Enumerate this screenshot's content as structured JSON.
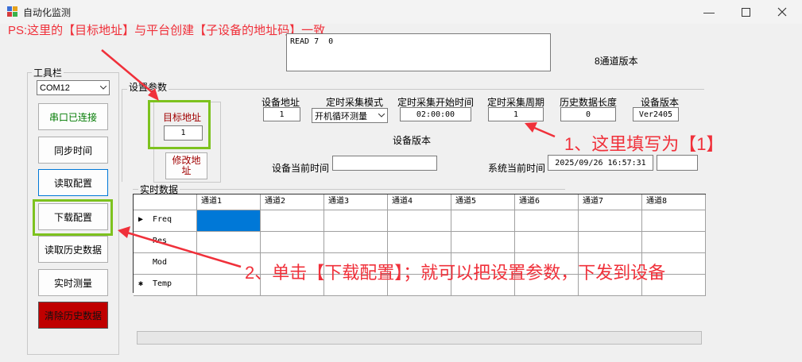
{
  "window": {
    "title": "自动化监测"
  },
  "annotations": {
    "ps": "PS:这里的【目标地址】与平台创建【子设备的地址码】一致",
    "step1": "1、这里填写为【1】",
    "step2": "2、单击【下载配置】；就可以把设置参数，下发到设备"
  },
  "output_text": "READ 7  0",
  "version_banner": "8通道版本",
  "toolbar": {
    "title": "工具栏",
    "port": "COM12",
    "buttons": {
      "connected": "串口已连接",
      "sync_time": "同步时间",
      "read_config": "读取配置",
      "download_config": "下载配置",
      "read_history": "读取历史数据",
      "realtime": "实时测量",
      "clear_history": "清除历史数据"
    }
  },
  "settings": {
    "title": "设置参数",
    "target_address_label": "目标地址",
    "target_address_value": "1",
    "modify_address": "修改地址",
    "device_address_label": "设备地址",
    "device_address_value": "1",
    "timer_mode_label": "定时采集模式",
    "timer_mode_value": "开机循环测量",
    "start_time_label": "定时采集开始时间",
    "start_time_value": "02:00:00",
    "period_label": "定时采集周期",
    "period_value": "1",
    "history_length_label": "历史数据长度",
    "history_length_value": "0",
    "device_version_label": "设备版本",
    "device_version_value": "Ver2405",
    "device_version_center": "设备版本",
    "device_time_label": "设备当前时间",
    "device_time_value": "",
    "system_time_label": "系统当前时间",
    "system_time_value": "2025/09/26 16:57:31"
  },
  "realtime": {
    "title": "实时数据",
    "columns": [
      "通道1",
      "通道2",
      "通道3",
      "通道4",
      "通道5",
      "通道6",
      "通道7",
      "通道8"
    ],
    "rows": [
      {
        "marker": "▶",
        "label": "Freq"
      },
      {
        "marker": "",
        "label": "Res"
      },
      {
        "marker": "",
        "label": "Mod"
      },
      {
        "marker": "✱",
        "label": "Temp"
      }
    ]
  },
  "colors": {
    "red_annotation": "#f0303a",
    "green_highlight": "#7dc21e",
    "selected_cell": "#0078d7",
    "dark_red_text": "#a00000",
    "green_text": "#007a00",
    "clear_button_bg": "#c00000"
  }
}
